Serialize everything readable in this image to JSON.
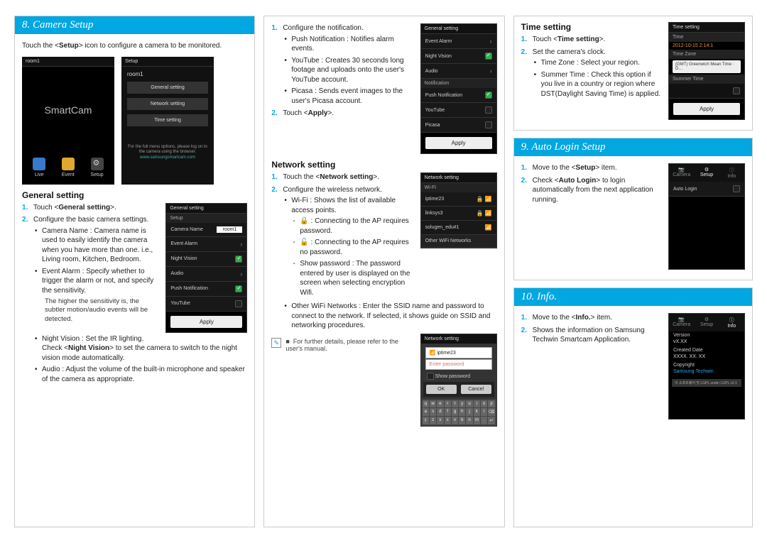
{
  "sec8": {
    "title": "8. Camera Setup",
    "intro": "Touch the <Setup> icon to configure a camera to be monitored.",
    "splash": {
      "room": "room1",
      "logo": "SmartCam",
      "tabs": {
        "live": "Live",
        "event": "Event",
        "setup": "Setup"
      }
    },
    "setup_panel": {
      "room": "room1",
      "items": [
        "General setting",
        "Network setting",
        "Time setting"
      ],
      "note": "For the full menu options, please log on to the camera using the browser.",
      "url": "www.samsungsmartcam.com"
    },
    "general": {
      "heading": "General setting",
      "step1": "Touch <General setting>.",
      "step2": "Configure the basic camera settings.",
      "b_camera_name": "Camera Name : Camera name is used to easily identify the camera when you have more than one. i.e., Living room, Kitchen, Bedroom.",
      "b_event_alarm": "Event Alarm : Specify whether to trigger the alarm or not, and specify the sensitivity.",
      "event_alarm_note": "The higher the sensitivity is, the subtler motion/audio events will be detected.",
      "b_night_vision": "Night Vision : Set the IR lighting.",
      "night_vision_note": "Check <Night Vision> to set the camera to switch to the night vision mode automatically.",
      "b_audio": "Audio : Adjust the volume of the built-in microphone and speaker of the camera as appropriate."
    },
    "general_phone": {
      "header": "General setting",
      "sub": "Setup",
      "camera_name_label": "Camera Name",
      "camera_name_value": "room1",
      "rows": [
        "Event Alarm",
        "Night Vision",
        "Audio",
        "Push Notification",
        "YouTube"
      ],
      "apply": "Apply"
    },
    "notif": {
      "step3": "Configure the notification.",
      "b_push": "Push Notification : Notifies alarm events.",
      "b_youtube": "YouTube : Creates 30 seconds long footage and uploads onto the user's YouTube account.",
      "b_picasa": "Picasa : Sends event images to the user's Picasa account.",
      "step4": "Touch <Apply>."
    },
    "notif_phone": {
      "header": "General setting",
      "rows": [
        "Event Alarm",
        "Night Vision",
        "Audio"
      ],
      "section": "Notification",
      "rows2": [
        "Push Notification",
        "YouTube",
        "Picasa"
      ],
      "apply": "Apply"
    },
    "network": {
      "heading": "Network setting",
      "step1": "Touch the <Network setting>.",
      "step2": "Configure the wireless network.",
      "b_wifi": "Wi-Fi : Shows the list of available access points.",
      "d_lock": "Connecting to the AP requires password.",
      "d_open": "Connecting to the AP requires no password.",
      "d_showpw": "Show password : The password entered by user is displayed on the screen when selecting encryption Wifi.",
      "b_other": "Other WiFi Networks : Enter the SSID name and password to connect to the network. If selected, it shows guide on SSID and networking procedures.",
      "note": "For further details, please refer to the user's manual."
    },
    "wifi_phone": {
      "header": "Network setting",
      "section": "Wi-Fi",
      "aps": [
        "iptime23",
        "linksys3",
        "solugen_edu#1"
      ],
      "other": "Other WiFi Networks"
    },
    "wifi_popup": {
      "header": "Network setting",
      "ssid": "iptime23",
      "placeholder": "Enter password",
      "show_pw": "Show password",
      "ok": "OK",
      "cancel": "Cancel"
    }
  },
  "time": {
    "heading": "Time setting",
    "step1": "Touch <Time setting>.",
    "step2": "Set the camera's clock.",
    "b_tz": "Time Zone : Select your region.",
    "b_summer": "Summer Time : Check this option if you live in a country or region where DST(Daylight Saving Time) is applied.",
    "phone": {
      "header": "Time setting",
      "time_label": "Time",
      "time_value": "2012-10-15 2:14:1",
      "tz_label": "Time Zone",
      "tz_value": "(GMT) Greenwich Mean Time : D…",
      "summer_label": "Summer Time",
      "apply": "Apply"
    }
  },
  "sec9": {
    "title": "9. Auto Login Setup",
    "step1": "Move to the <Setup> item.",
    "step2": "Check <Auto Login> to login automatically from the next application running.",
    "phone": {
      "tabs": [
        "Camera",
        "Setup",
        "Info"
      ],
      "row": "Auto Login"
    }
  },
  "sec10": {
    "title": "10. Info.",
    "step1": "Move to the <Info.> item.",
    "step2": "Shows the information on Samsung Techwin Smartcam Application.",
    "phone": {
      "tabs": [
        "Camera",
        "Setup",
        "Info"
      ],
      "version_label": "Version",
      "version_value": "vX.XX",
      "created_label": "Created Date",
      "created_value": "XXXX. XX. XX",
      "copyright_label": "Copyright",
      "copyright_value": "Samsung Techwin",
      "footer": "이 소프트웨어 및 LGPL under LGPL v2.1"
    }
  }
}
